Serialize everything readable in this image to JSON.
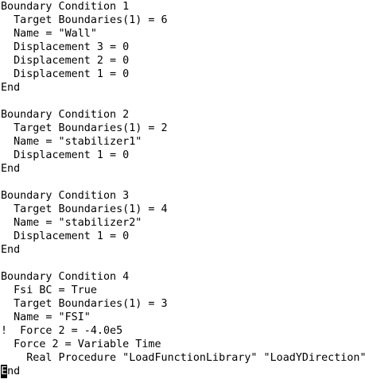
{
  "editor": {
    "lines": [
      "Boundary Condition 1",
      "  Target Boundaries(1) = 6",
      "  Name = \"Wall\"",
      "  Displacement 3 = 0",
      "  Displacement 2 = 0",
      "  Displacement 1 = 0",
      "End",
      "",
      "Boundary Condition 2",
      "  Target Boundaries(1) = 2",
      "  Name = \"stabilizer1\"",
      "  Displacement 1 = 0",
      "End",
      "",
      "Boundary Condition 3",
      "  Target Boundaries(1) = 4",
      "  Name = \"stabilizer2\"",
      "  Displacement 1 = 0",
      "End",
      "",
      "Boundary Condition 4",
      "  Fsi BC = True",
      "  Target Boundaries(1) = 3",
      "  Name = \"FSI\"",
      "!  Force 2 = -4.0e5",
      "  Force 2 = Variable Time",
      "    Real Procedure \"LoadFunctionLibrary\" \"LoadYDirection\""
    ],
    "last_line": {
      "cursor_char": "E",
      "rest": "nd"
    }
  }
}
